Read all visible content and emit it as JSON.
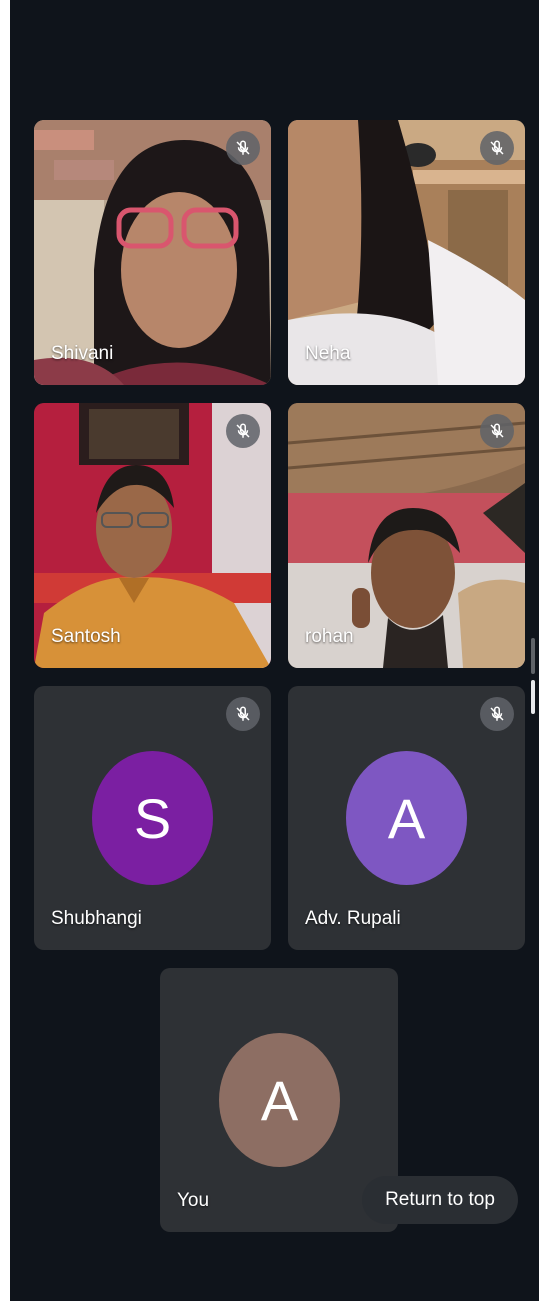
{
  "participants": [
    {
      "name": "Shivani",
      "type": "video",
      "muted": true
    },
    {
      "name": "Neha",
      "type": "video",
      "muted": true
    },
    {
      "name": "Santosh",
      "type": "video",
      "muted": true
    },
    {
      "name": "rohan",
      "type": "video",
      "muted": true
    },
    {
      "name": "Shubhangi",
      "type": "avatar",
      "initial": "S",
      "avatar_color": "#7b1fa2",
      "muted": true
    },
    {
      "name": "Adv. Rupali",
      "type": "avatar",
      "initial": "A",
      "avatar_color": "#7e57c2",
      "muted": true
    }
  ],
  "self": {
    "name": "You",
    "initial": "A",
    "avatar_color": "#8d6e63"
  },
  "return_to_top": "Return to top",
  "icons": {
    "mute": "mic-off-icon"
  },
  "colors": {
    "background": "#0f141b",
    "tile": "#2e3135"
  }
}
